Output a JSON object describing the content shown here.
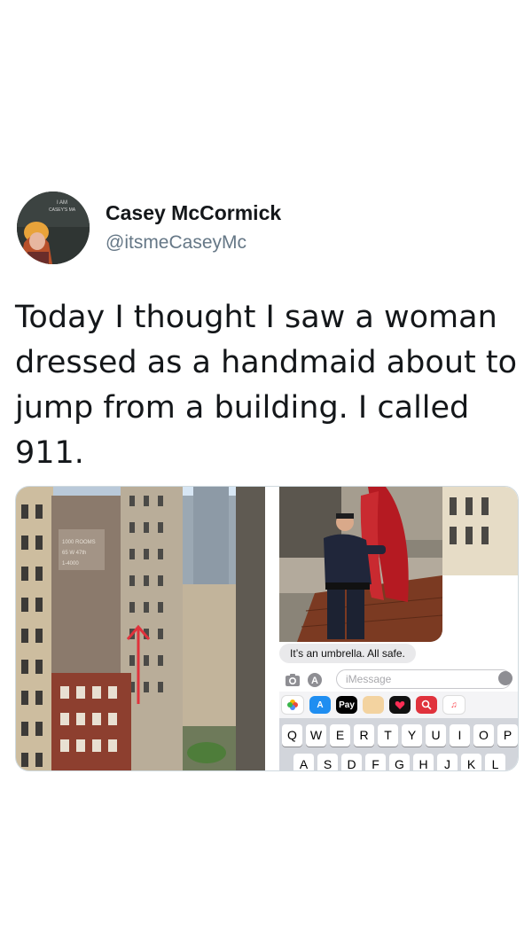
{
  "author": {
    "display_name": "Casey McCormick",
    "handle": "@itsmeCaseyMc",
    "avatar_label": "I AM CASEY'S MA"
  },
  "tweet": {
    "text": "Today I thought I saw a woman dressed as a handmaid about to jump from a building. I called 911."
  },
  "media": {
    "left_photo": {
      "description_icon": "cityscape-photo",
      "sign_text": "1000 ROOMS 65 W 47th 1-4000",
      "arrow_color": "#e0323c"
    },
    "messages_screenshot": {
      "bubble_text": "It’s an umbrella. All safe.",
      "input_placeholder": "iMessage",
      "app_chips": [
        "photos",
        "appstore",
        "Pay",
        "memoji",
        "heart",
        "search",
        "music"
      ],
      "pay_label": "Pay",
      "keyboard_row1": [
        "Q",
        "W",
        "E",
        "R",
        "T",
        "Y",
        "U",
        "I",
        "O",
        "P"
      ],
      "keyboard_row2": [
        "A",
        "S",
        "D",
        "F",
        "G",
        "H",
        "J",
        "K",
        "L"
      ]
    }
  },
  "colors": {
    "handle_gray": "#657786",
    "bubble_gray": "#e9e9eb",
    "umbrella_red": "#b51a22"
  }
}
